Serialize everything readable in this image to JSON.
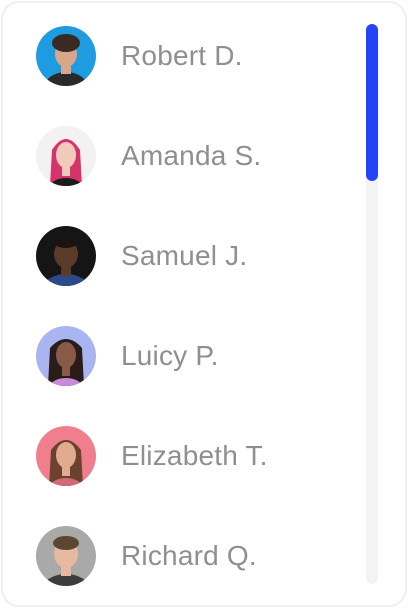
{
  "contacts": [
    {
      "name": "Robert D.",
      "avatar_bg": "#1f9be0",
      "skin": "#d9a689",
      "hair": "#3a2a22",
      "shirt": "#2a2a2a"
    },
    {
      "name": "Amanda S.",
      "avatar_bg": "#f3f1f2",
      "skin": "#f1c9bd",
      "hair": "#d6336b",
      "shirt": "#1c1c1c"
    },
    {
      "name": "Samuel J.",
      "avatar_bg": "#151515",
      "skin": "#5a3a28",
      "hair": "#1a1410",
      "shirt": "#2b4a8a"
    },
    {
      "name": "Luicy P.",
      "avatar_bg": "#a9b5f0",
      "skin": "#8a5a48",
      "hair": "#2a1c18",
      "shirt": "#c78bd8"
    },
    {
      "name": "Elizabeth T.",
      "avatar_bg": "#f07f8d",
      "skin": "#e0ab8e",
      "hair": "#6b4230",
      "shirt": "#d06a78"
    },
    {
      "name": "Richard Q.",
      "avatar_bg": "#a8aaa8",
      "skin": "#e7b9a0",
      "hair": "#5c4632",
      "shirt": "#3c3c3c"
    }
  ],
  "scrollbar": {
    "thumb_color": "#2544f5",
    "track_color": "#f2f3f3"
  }
}
